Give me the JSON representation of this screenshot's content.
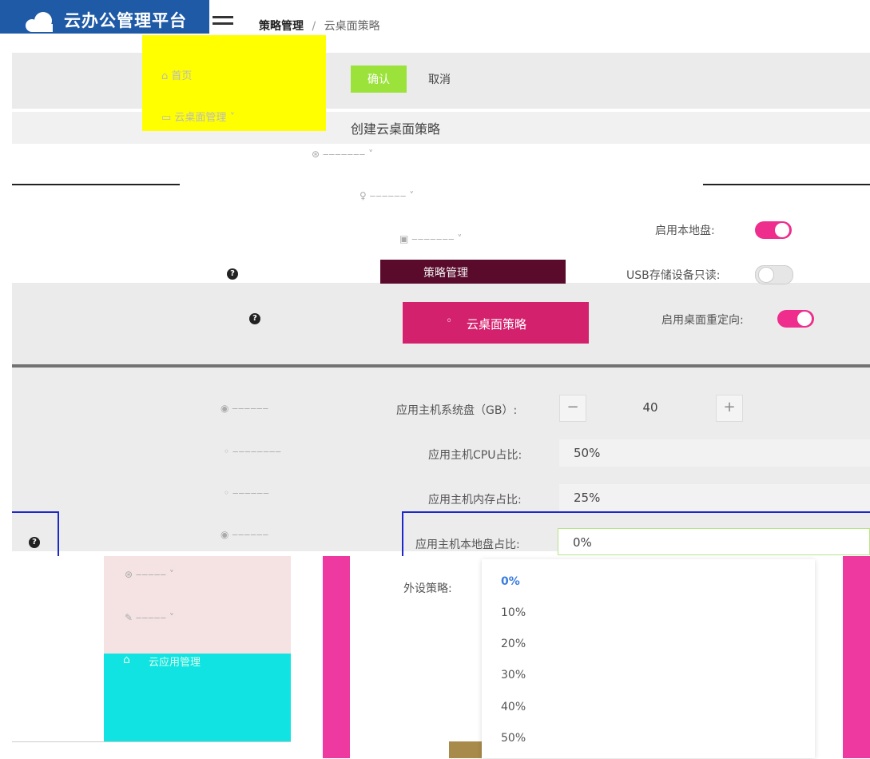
{
  "app": {
    "title": "云办公管理平台"
  },
  "breadcrumb": {
    "current": "策略管理",
    "separator": "/",
    "leaf": "云桌面策略"
  },
  "sidebar": {
    "home": "首页",
    "desktop_manage": "云桌面管理",
    "policy_manage": "策略管理",
    "desktop_policy": "云桌面策略",
    "cloud_app": "云应用管理"
  },
  "toolbar": {
    "confirm": "确认",
    "cancel": "取消"
  },
  "form": {
    "title": "创建云桌面策略",
    "local_disk_label": "启用本地盘:",
    "usb_readonly_label": "USB存储设备只读:",
    "desktop_redirect_label": "启用桌面重定向:",
    "system_disk_label": "应用主机系统盘（GB）:",
    "system_disk_value": "40",
    "cpu_label": "应用主机CPU占比:",
    "cpu_value": "50%",
    "memory_label": "应用主机内存占比:",
    "memory_value": "25%",
    "local_disk_ratio_label": "应用主机本地盘占比:",
    "local_disk_ratio_value": "0%",
    "peripheral_label": "外设策略:"
  },
  "switches": {
    "local_disk": true,
    "usb_readonly": false,
    "desktop_redirect": true
  },
  "dropdown": {
    "options": [
      "0%",
      "10%",
      "20%",
      "30%",
      "40%",
      "50%"
    ],
    "selected": "0%"
  },
  "colors": {
    "logo_blue": "#1f5aa6",
    "accent_pink": "#ee2d8c",
    "confirm_green": "#9be33a",
    "selected_blue": "#3a7de0"
  },
  "icons": {
    "help": "?",
    "minus": "−",
    "plus": "+"
  }
}
